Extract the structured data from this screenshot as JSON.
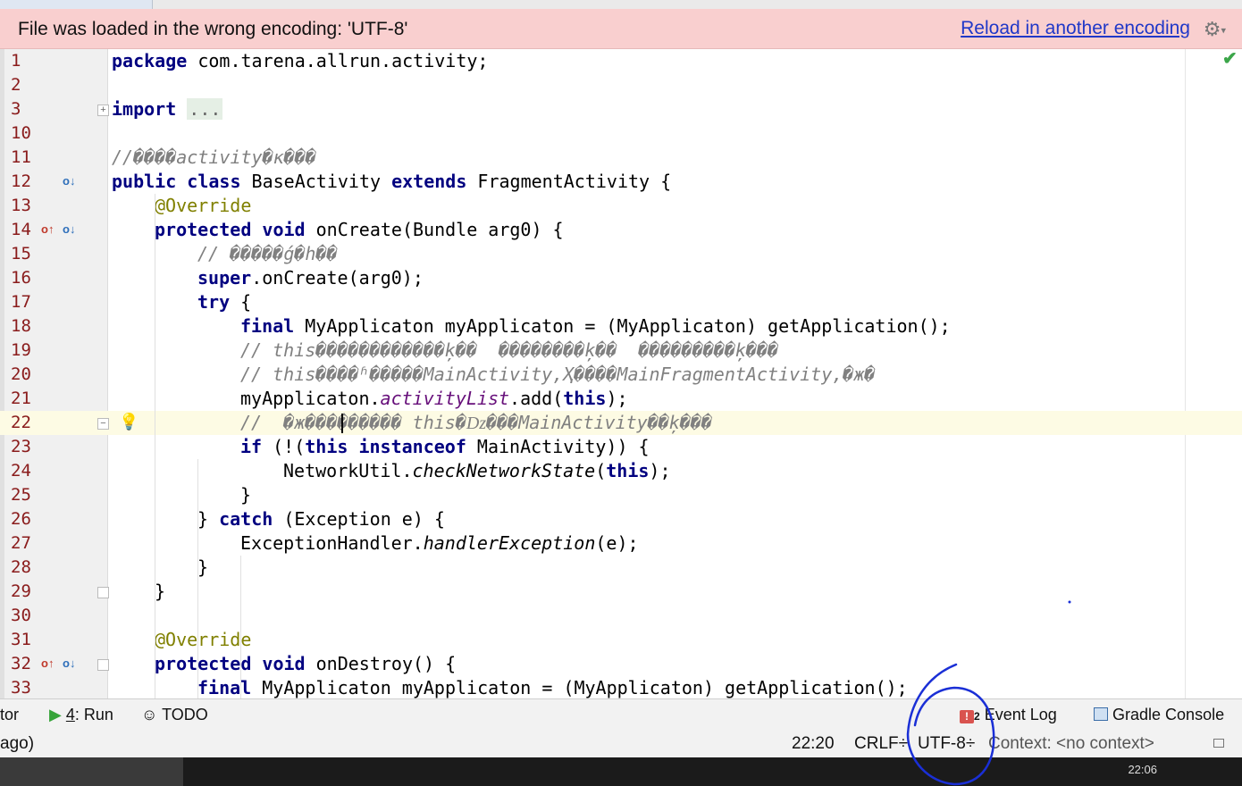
{
  "banner": {
    "message": "File was loaded in the wrong encoding: 'UTF-8'",
    "link": "Reload in another encoding",
    "gear_icon": "gear-icon"
  },
  "editor": {
    "lines": [
      {
        "n": "1",
        "indent": 0,
        "tokens": [
          {
            "t": "package",
            "c": "kw"
          },
          {
            "t": " com.tarena.allrun.activity;"
          }
        ]
      },
      {
        "n": "2",
        "indent": 0,
        "tokens": []
      },
      {
        "n": "3",
        "indent": 0,
        "tokens": [
          {
            "t": "import",
            "c": "kw"
          },
          {
            "t": " "
          },
          {
            "t": "...",
            "c": "fold-dots"
          }
        ]
      },
      {
        "n": "10",
        "indent": 0,
        "tokens": []
      },
      {
        "n": "11",
        "indent": 0,
        "tokens": [
          {
            "t": "//����activity�к���",
            "c": "cmt"
          }
        ]
      },
      {
        "n": "12",
        "indent": 0,
        "tokens": [
          {
            "t": "public class",
            "c": "kw"
          },
          {
            "t": " BaseActivity "
          },
          {
            "t": "extends",
            "c": "kw"
          },
          {
            "t": " FragmentActivity {"
          }
        ]
      },
      {
        "n": "13",
        "indent": 1,
        "tokens": [
          {
            "t": "@Override",
            "c": "ann"
          }
        ]
      },
      {
        "n": "14",
        "indent": 1,
        "tokens": [
          {
            "t": "protected void",
            "c": "kw"
          },
          {
            "t": " onCreate(Bundle arg0) {"
          }
        ]
      },
      {
        "n": "15",
        "indent": 2,
        "tokens": [
          {
            "t": "// �����ǵ�һ��",
            "c": "cmt"
          }
        ]
      },
      {
        "n": "16",
        "indent": 2,
        "tokens": [
          {
            "t": "super",
            "c": "kw"
          },
          {
            "t": ".onCreate(arg0);"
          }
        ]
      },
      {
        "n": "17",
        "indent": 2,
        "tokens": [
          {
            "t": "try",
            "c": "kw"
          },
          {
            "t": " {"
          }
        ]
      },
      {
        "n": "18",
        "indent": 3,
        "tokens": [
          {
            "t": "final",
            "c": "kw"
          },
          {
            "t": " MyApplicaton myApplicaton = (MyApplicaton) getApplication();"
          }
        ]
      },
      {
        "n": "19",
        "indent": 3,
        "tokens": [
          {
            "t": "// this������������ķ��  ��������ķ��  ���������ķ���",
            "c": "cmt"
          }
        ]
      },
      {
        "n": "20",
        "indent": 3,
        "tokens": [
          {
            "t": "// this����ʱ�����MainActivity,Ҳ����MainFragmentActivity,�ж�",
            "c": "cmt"
          }
        ]
      },
      {
        "n": "21",
        "indent": 3,
        "tokens": [
          {
            "t": "myApplicaton."
          },
          {
            "t": "activityList",
            "c": "fld"
          },
          {
            "t": ".add("
          },
          {
            "t": "this",
            "c": "kw"
          },
          {
            "t": ");"
          }
        ]
      },
      {
        "n": "22",
        "indent": 3,
        "tokens": [
          {
            "t": "//  �ж��������� this�ǲ���MainActivity��ķ���",
            "c": "cmt"
          }
        ]
      },
      {
        "n": "23",
        "indent": 3,
        "tokens": [
          {
            "t": "if",
            "c": "kw"
          },
          {
            "t": " (!("
          },
          {
            "t": "this instanceof",
            "c": "kw"
          },
          {
            "t": " MainActivity)) {"
          }
        ]
      },
      {
        "n": "24",
        "indent": 4,
        "tokens": [
          {
            "t": "NetworkUtil."
          },
          {
            "t": "checkNetworkState",
            "c": "stat"
          },
          {
            "t": "("
          },
          {
            "t": "this",
            "c": "kw"
          },
          {
            "t": ");"
          }
        ]
      },
      {
        "n": "25",
        "indent": 3,
        "tokens": [
          {
            "t": "}"
          }
        ]
      },
      {
        "n": "26",
        "indent": 2,
        "tokens": [
          {
            "t": "} "
          },
          {
            "t": "catch",
            "c": "kw"
          },
          {
            "t": " (Exception e) {"
          }
        ]
      },
      {
        "n": "27",
        "indent": 3,
        "tokens": [
          {
            "t": "ExceptionHandler."
          },
          {
            "t": "handlerException",
            "c": "stat"
          },
          {
            "t": "(e);"
          }
        ]
      },
      {
        "n": "28",
        "indent": 2,
        "tokens": [
          {
            "t": "}"
          }
        ]
      },
      {
        "n": "29",
        "indent": 1,
        "tokens": [
          {
            "t": "}"
          }
        ]
      },
      {
        "n": "30",
        "indent": 0,
        "tokens": []
      },
      {
        "n": "31",
        "indent": 1,
        "tokens": [
          {
            "t": "@Override",
            "c": "ann"
          }
        ]
      },
      {
        "n": "32",
        "indent": 1,
        "tokens": [
          {
            "t": "protected void",
            "c": "kw"
          },
          {
            "t": " onDestroy() {"
          }
        ]
      },
      {
        "n": "33",
        "indent": 2,
        "tokens": [
          {
            "t": "final",
            "c": "kw"
          },
          {
            "t": " MyApplicaton myApplicaton = (MyApplicaton) getApplication();"
          }
        ]
      }
    ],
    "current_line": "22"
  },
  "toolbar": {
    "editor_tab": "tor",
    "run_num": "4",
    "run_label": ": Run",
    "todo": "TODO",
    "event_count": "2",
    "event_log": "Event Log",
    "gradle": "Gradle Console"
  },
  "statusbar": {
    "left": "ago)",
    "position": "22:20",
    "line_sep": "CRLF÷",
    "encoding": "UTF-8÷",
    "context": "Context: <no context>"
  },
  "taskbar": {
    "clock": "22:06"
  }
}
